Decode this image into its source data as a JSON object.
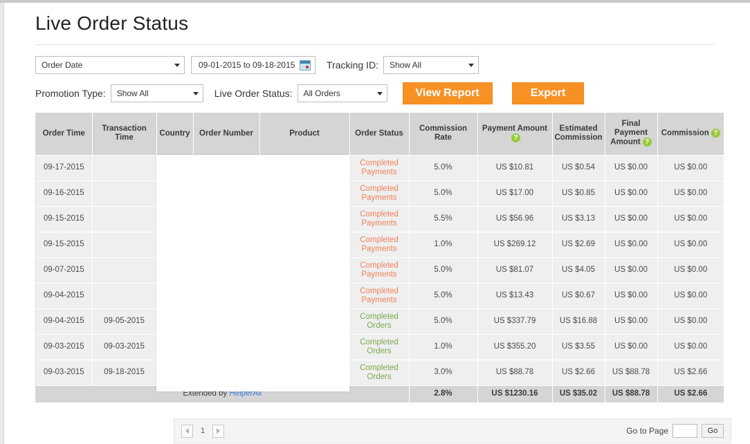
{
  "page_title": "Live Order Status",
  "filters": {
    "date_type": "Order Date",
    "date_range": "09-01-2015 to 09-18-2015",
    "calendar_icon": "calendar-icon",
    "tracking_label": "Tracking ID:",
    "tracking_value": "Show All",
    "promotion_label": "Promotion Type:",
    "promotion_value": "Show All",
    "order_status_label": "Live Order Status:",
    "order_status_value": "All Orders",
    "view_report_label": "View Report",
    "export_label": "Export"
  },
  "table": {
    "columns": [
      {
        "label": "Order Time",
        "help": false
      },
      {
        "label": "Transaction Time",
        "help": false
      },
      {
        "label": "Country",
        "help": false
      },
      {
        "label": "Order Number",
        "help": false
      },
      {
        "label": "Product",
        "help": false
      },
      {
        "label": "Order Status",
        "help": false
      },
      {
        "label": "Commission Rate",
        "help": false
      },
      {
        "label": "Payment Amount",
        "help": true
      },
      {
        "label": "Estimated Commission",
        "help": false
      },
      {
        "label": "Final Payment Amount",
        "help": true
      },
      {
        "label": "Commission",
        "help": true
      }
    ],
    "rows": [
      {
        "order_time": "09-17-2015",
        "transaction_time": "",
        "country": "",
        "order_number": "",
        "product": "",
        "order_status": "Completed Payments",
        "status_kind": "payments",
        "commission_rate": "5.0%",
        "payment_amount": "US $10.81",
        "estimated_commission": "US $0.54",
        "final_payment_amount": "US $0.00",
        "commission": "US $0.00"
      },
      {
        "order_time": "09-16-2015",
        "transaction_time": "",
        "country": "",
        "order_number": "",
        "product": "",
        "order_status": "Completed Payments",
        "status_kind": "payments",
        "commission_rate": "5.0%",
        "payment_amount": "US $17.00",
        "estimated_commission": "US $0.85",
        "final_payment_amount": "US $0.00",
        "commission": "US $0.00"
      },
      {
        "order_time": "09-15-2015",
        "transaction_time": "",
        "country": "",
        "order_number": "",
        "product": "",
        "order_status": "Completed Payments",
        "status_kind": "payments",
        "commission_rate": "5.5%",
        "payment_amount": "US $56.96",
        "estimated_commission": "US $3.13",
        "final_payment_amount": "US $0.00",
        "commission": "US $0.00"
      },
      {
        "order_time": "09-15-2015",
        "transaction_time": "",
        "country": "",
        "order_number": "",
        "product": "",
        "order_status": "Completed Payments",
        "status_kind": "payments",
        "commission_rate": "1.0%",
        "payment_amount": "US $269.12",
        "estimated_commission": "US $2.69",
        "final_payment_amount": "US $0.00",
        "commission": "US $0.00"
      },
      {
        "order_time": "09-07-2015",
        "transaction_time": "",
        "country": "",
        "order_number": "",
        "product": "",
        "order_status": "Completed Payments",
        "status_kind": "payments",
        "commission_rate": "5.0%",
        "payment_amount": "US $81.07",
        "estimated_commission": "US $4.05",
        "final_payment_amount": "US $0.00",
        "commission": "US $0.00"
      },
      {
        "order_time": "09-04-2015",
        "transaction_time": "",
        "country": "",
        "order_number": "",
        "product": "",
        "order_status": "Completed Payments",
        "status_kind": "payments",
        "commission_rate": "5.0%",
        "payment_amount": "US $13.43",
        "estimated_commission": "US $0.67",
        "final_payment_amount": "US $0.00",
        "commission": "US $0.00"
      },
      {
        "order_time": "09-04-2015",
        "transaction_time": "09-05-2015",
        "country": "",
        "order_number": "",
        "product": "",
        "order_status": "Completed Orders",
        "status_kind": "orders",
        "commission_rate": "5.0%",
        "payment_amount": "US $337.79",
        "estimated_commission": "US $16.88",
        "final_payment_amount": "US $0.00",
        "commission": "US $0.00"
      },
      {
        "order_time": "09-03-2015",
        "transaction_time": "09-03-2015",
        "country": "",
        "order_number": "",
        "product": "",
        "order_status": "Completed Orders",
        "status_kind": "orders",
        "commission_rate": "1.0%",
        "payment_amount": "US $355.20",
        "estimated_commission": "US $3.55",
        "final_payment_amount": "US $0.00",
        "commission": "US $0.00"
      },
      {
        "order_time": "09-03-2015",
        "transaction_time": "09-18-2015",
        "country": "",
        "order_number": "",
        "product": "",
        "order_status": "Completed Orders",
        "status_kind": "orders",
        "commission_rate": "3.0%",
        "payment_amount": "US $88.78",
        "estimated_commission": "US $2.66",
        "final_payment_amount": "US $88.78",
        "commission": "US $2.66"
      }
    ],
    "total_row": {
      "extended_by_prefix": "Extended by ",
      "extended_by_brand": "HelperAli",
      "commission_rate": "2.8%",
      "payment_amount": "US $1230.16",
      "estimated_commission": "US $35.02",
      "final_payment_amount": "US $88.78",
      "commission": "US $2.66"
    }
  },
  "pagination": {
    "prev_icon": "chevron-left-icon",
    "next_icon": "chevron-right-icon",
    "current_page": "1",
    "go_to_page_label": "Go to Page",
    "go_to_page_value": "",
    "go_label": "Go"
  },
  "colors": {
    "accent_orange": "#f79124",
    "status_payments": "#f0815a",
    "status_orders": "#7aa94b",
    "help_green": "#9ac93a",
    "brand_link": "#3a7bd5",
    "header_grey": "#d5d5d5",
    "row_grey": "#efefef"
  }
}
